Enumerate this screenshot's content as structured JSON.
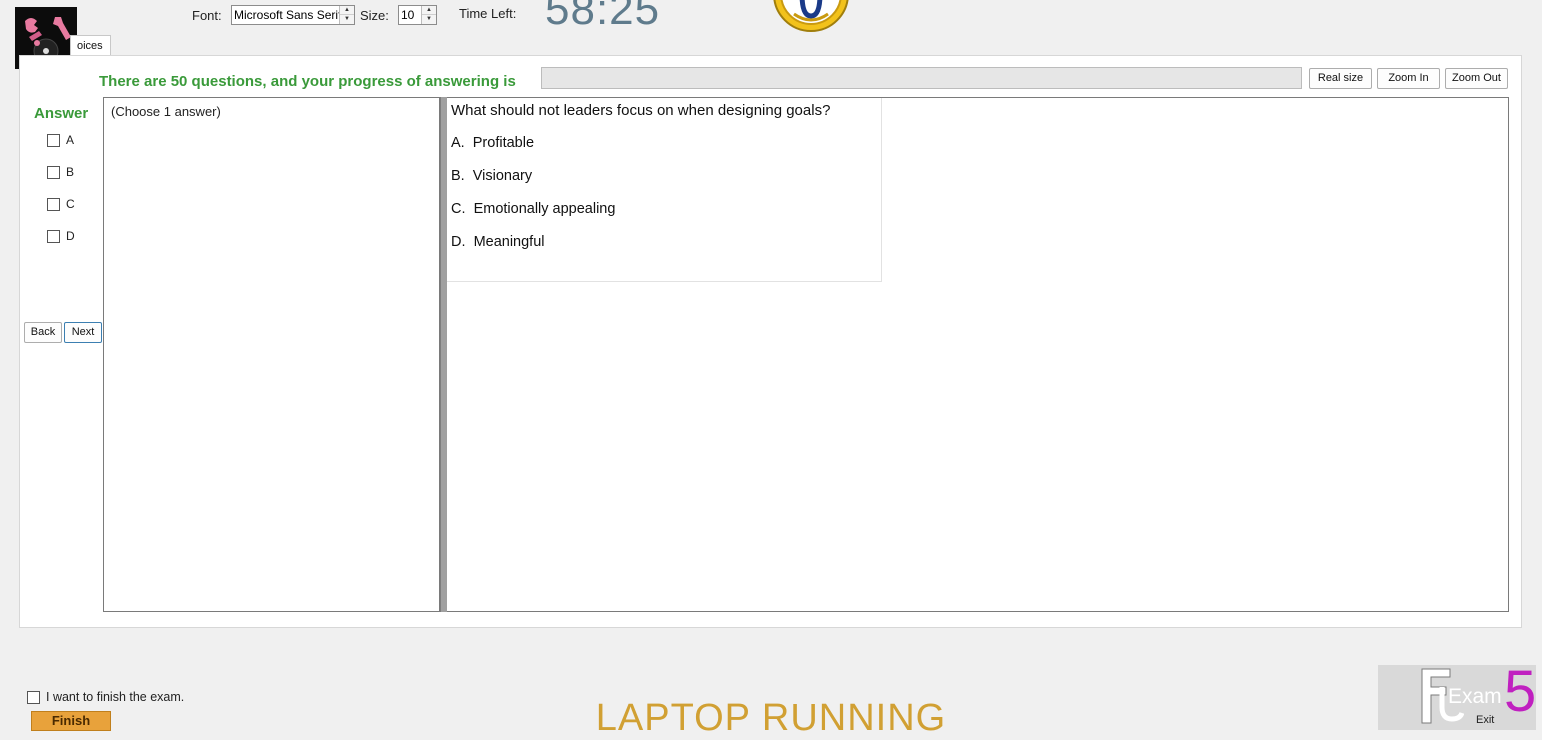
{
  "toolbar": {
    "font_label": "Font:",
    "font_value": "Microsoft Sans Serif",
    "size_label": "Size:",
    "size_value": "10",
    "time_left_label": "Time Left:",
    "timer": "58:25"
  },
  "tab": {
    "label": "oices"
  },
  "progress": {
    "text": "There are 50 questions, and your progress of answering is",
    "fraction": 0
  },
  "zoom": {
    "real_size": "Real size",
    "zoom_in": "Zoom In",
    "zoom_out": "Zoom Out"
  },
  "answer": {
    "title": "Answer",
    "options": [
      "A",
      "B",
      "C",
      "D"
    ]
  },
  "nav": {
    "back": "Back",
    "next": "Next"
  },
  "choices_hint": "(Choose 1 answer)",
  "question": {
    "text": "What should not leaders focus on when designing goals?",
    "options": [
      {
        "letter": "A.",
        "text": "Profitable"
      },
      {
        "letter": "B.",
        "text": "Visionary"
      },
      {
        "letter": "C.",
        "text": "Emotionally appealing"
      },
      {
        "letter": "D.",
        "text": "Meaningful"
      }
    ]
  },
  "footer": {
    "finish_checkbox_label": "I want to finish the exam.",
    "finish_button": "Finish",
    "banner": "LAPTOP RUNNING",
    "exam_logo_text": "Exam",
    "exam_number": "5",
    "exit_label": "Exit"
  },
  "colors": {
    "accent_green": "#3a9a3a",
    "timer": "#5f7b8c",
    "finish_button": "#e8a23b",
    "banner": "#d1a033",
    "exam_number": "#c020c0"
  }
}
